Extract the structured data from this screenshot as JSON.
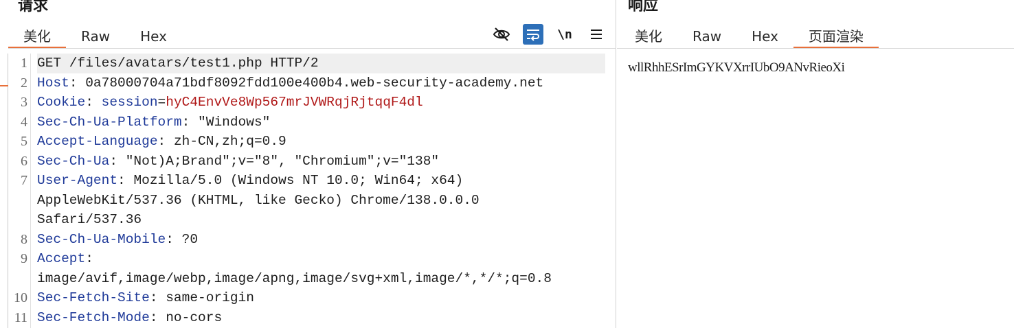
{
  "request": {
    "title": "请求",
    "tabs": [
      "美化",
      "Raw",
      "Hex"
    ],
    "active_tab": "美化",
    "toolbar": {
      "newline_label": "\\n"
    },
    "lines": [
      {
        "n": "1",
        "key": "",
        "sep": "",
        "val": "GET /files/avatars/test1.php HTTP/2",
        "plain": "GET /files/avatars/test1.php HTTP/2"
      },
      {
        "n": "2",
        "key": "Host",
        "sep": ": ",
        "val": "0a78000704a71bdf8092fdd100e400b4.web-security-academy.net"
      },
      {
        "n": "3",
        "key": "Cookie",
        "sep": ": ",
        "key2": "session",
        "eq": "=",
        "val2": "hyC4EnvVe8Wp567mrJVWRqjRjtqqF4dl"
      },
      {
        "n": "4",
        "key": "Sec-Ch-Ua-Platform",
        "sep": ": ",
        "val": "\"Windows\""
      },
      {
        "n": "5",
        "key": "Accept-Language",
        "sep": ": ",
        "val": "zh-CN,zh;q=0.9"
      },
      {
        "n": "6",
        "key": "Sec-Ch-Ua",
        "sep": ": ",
        "val": "\"Not)A;Brand\";v=\"8\", \"Chromium\";v=\"138\""
      },
      {
        "n": "7",
        "key": "User-Agent",
        "sep": ": ",
        "val": "Mozilla/5.0 (Windows NT 10.0; Win64; x64)"
      },
      {
        "n": "",
        "key": "",
        "sep": "",
        "val": "AppleWebKit/537.36 (KHTML, like Gecko) Chrome/138.0.0.0"
      },
      {
        "n": "",
        "key": "",
        "sep": "",
        "val": "Safari/537.36"
      },
      {
        "n": "8",
        "key": "Sec-Ch-Ua-Mobile",
        "sep": ": ",
        "val": "?0"
      },
      {
        "n": "9",
        "key": "Accept",
        "sep": ":",
        "val": ""
      },
      {
        "n": "",
        "key": "",
        "sep": "",
        "val": "image/avif,image/webp,image/apng,image/svg+xml,image/*,*/*;q=0.8"
      },
      {
        "n": "10",
        "key": "Sec-Fetch-Site",
        "sep": ": ",
        "val": "same-origin"
      },
      {
        "n": "11",
        "key": "Sec-Fetch-Mode",
        "sep": ": ",
        "val": "no-cors"
      }
    ]
  },
  "response": {
    "title": "响应",
    "tabs": [
      "美化",
      "Raw",
      "Hex",
      "页面渲染"
    ],
    "active_tab": "页面渲染",
    "body_text": "wllRhhESrImGYKVXrrIUbO9ANvRieoXi"
  },
  "colors": {
    "accent": "#e8703a",
    "header_key": "#1f3a99",
    "cookie_value": "#b01818",
    "active_tool": "#2d6fb8"
  },
  "icons": [
    "eye-off-icon",
    "wrap-icon",
    "newline-icon",
    "menu-icon"
  ]
}
